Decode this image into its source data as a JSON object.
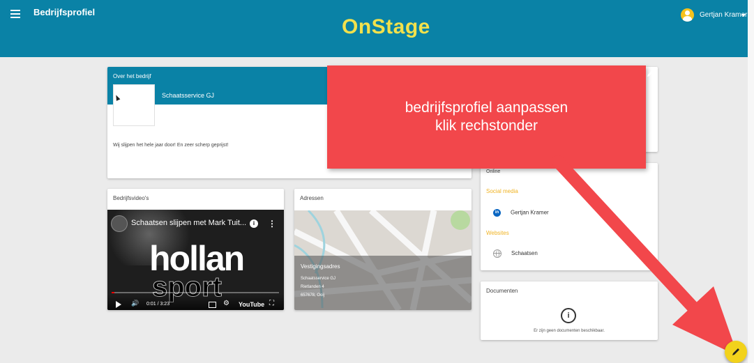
{
  "header": {
    "title": "Bedrijfsprofiel",
    "logo": "OnStage",
    "user_name": "Gertjan Kramer",
    "menu_icon": "hamburger-icon",
    "colors": {
      "bar": "#0a82a6",
      "logo": "#f2e14c"
    }
  },
  "about": {
    "title": "Over het bedrijf",
    "company_name": "Schaatsservice GJ",
    "description": "Wij slijpen het hele jaar door! En zeer scherp geprijst!"
  },
  "videos": {
    "title": "Bedrijfsvideo's",
    "video_title": "Schaatsen slijpen met Mark Tuit...",
    "overlay_line1": "hollan",
    "overlay_line2": "sport",
    "time": "0:01 / 3:23",
    "player_brand": "YouTube"
  },
  "addresses": {
    "title": "Adressen",
    "overlay_title": "Vestigingsadres",
    "lines": [
      "Schaatsservice GJ",
      "Rietlanden 4",
      "657678, Ooij"
    ]
  },
  "online": {
    "title": "Online",
    "social_heading": "Social media",
    "social_items": [
      {
        "label": "Gertjan Kramer",
        "icon": "linkedin-icon"
      }
    ],
    "websites_heading": "Websites",
    "website_items": [
      {
        "label": "Schaatsen",
        "icon": "globe-icon"
      }
    ]
  },
  "documents": {
    "title": "Documenten",
    "empty_text": "Er zijn geen documenten beschikbaar."
  },
  "callout": {
    "line1": "bedrijfsprofiel aanpassen",
    "line2": "klik rechstonder",
    "color": "#f2474b"
  },
  "fab": {
    "icon": "pencil-icon",
    "color": "#f2d21b"
  }
}
